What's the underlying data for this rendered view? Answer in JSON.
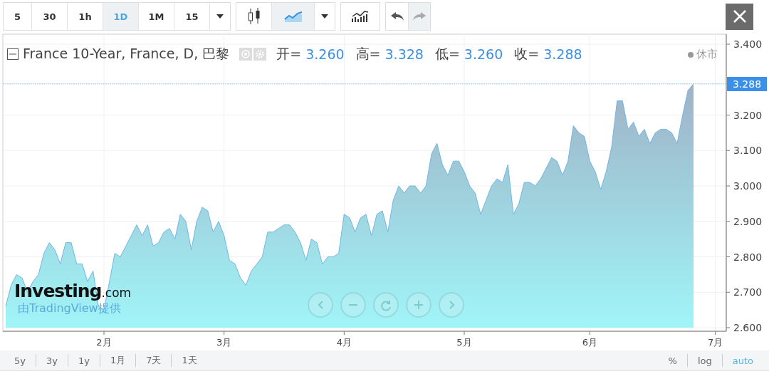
{
  "toolbar": {
    "intervals": [
      {
        "label": "5",
        "selected": false
      },
      {
        "label": "30",
        "selected": false
      },
      {
        "label": "1h",
        "selected": false
      },
      {
        "label": "1D",
        "selected": true
      },
      {
        "label": "1M",
        "selected": false
      },
      {
        "label": "15",
        "selected": false
      }
    ],
    "chart_styles": [
      {
        "kind": "candles",
        "selected": false
      },
      {
        "kind": "area",
        "selected": true
      }
    ],
    "undo": {
      "disabled": false
    },
    "redo": {
      "disabled": true
    }
  },
  "legend": {
    "title": "France 10-Year, France, D, 巴黎",
    "fields": [
      {
        "label": "开=",
        "value": "3.260"
      },
      {
        "label": "高=",
        "value": "3.328"
      },
      {
        "label": "低=",
        "value": "3.260"
      },
      {
        "label": "收=",
        "value": "3.288"
      }
    ],
    "market_status": "休市"
  },
  "chart": {
    "price_tag": "3.288",
    "chart_data": {
      "type": "area",
      "categories": [
        null,
        null,
        null,
        null,
        null,
        null,
        null,
        null,
        null,
        null,
        null,
        null,
        null,
        null,
        null,
        null,
        null,
        null,
        "2月",
        null,
        null,
        null,
        null,
        null,
        null,
        null,
        null,
        null,
        null,
        null,
        null,
        null,
        null,
        null,
        null,
        null,
        null,
        null,
        null,
        null,
        "3月",
        null,
        null,
        null,
        null,
        null,
        null,
        null,
        null,
        null,
        null,
        null,
        null,
        null,
        null,
        null,
        null,
        null,
        null,
        null,
        null,
        null,
        "4月",
        null,
        null,
        null,
        null,
        null,
        null,
        null,
        null,
        null,
        null,
        null,
        null,
        null,
        null,
        null,
        null,
        null,
        null,
        null,
        null,
        null,
        "5月",
        null,
        null,
        null,
        null,
        null,
        null,
        null,
        null,
        null,
        null,
        null,
        null,
        null,
        null,
        null,
        null,
        null,
        null,
        null,
        null,
        null,
        null,
        "6月",
        null,
        null,
        null,
        null,
        null,
        null,
        null,
        null,
        null,
        null,
        null,
        null,
        null,
        null,
        null,
        null,
        null,
        null,
        null,
        null,
        null,
        null,
        "7月"
      ],
      "series": [
        {
          "color": "#6fb6e6",
          "values": [
            2.66,
            2.72,
            2.75,
            2.74,
            2.7,
            2.73,
            2.75,
            2.81,
            2.84,
            2.82,
            2.78,
            2.84,
            2.84,
            2.78,
            2.78,
            2.73,
            2.76,
            2.66,
            2.65,
            2.73,
            2.81,
            2.8,
            2.83,
            2.86,
            2.89,
            2.86,
            2.89,
            2.83,
            2.84,
            2.87,
            2.88,
            2.85,
            2.92,
            2.9,
            2.82,
            2.9,
            2.94,
            2.93,
            2.87,
            2.9,
            2.86,
            2.79,
            2.78,
            2.74,
            2.72,
            2.76,
            2.78,
            2.8,
            2.87,
            2.87,
            2.88,
            2.89,
            2.89,
            2.87,
            2.84,
            2.79,
            2.85,
            2.84,
            2.78,
            2.8,
            2.8,
            2.81,
            2.92,
            2.91,
            2.87,
            2.91,
            2.92,
            2.86,
            2.92,
            2.93,
            2.87,
            2.96,
            3.0,
            2.98,
            3.0,
            3.0,
            2.98,
            3.0,
            3.09,
            3.12,
            3.06,
            3.03,
            3.07,
            3.07,
            3.04,
            3.0,
            2.98,
            2.92,
            2.96,
            3.0,
            3.02,
            3.01,
            3.06,
            2.92,
            2.95,
            3.01,
            3.01,
            3.0,
            3.02,
            3.05,
            3.08,
            3.07,
            3.03,
            3.07,
            3.17,
            3.15,
            3.14,
            3.07,
            3.04,
            2.99,
            3.04,
            3.11,
            3.24,
            3.24,
            3.16,
            3.18,
            3.14,
            3.16,
            3.12,
            3.15,
            3.16,
            3.16,
            3.15,
            3.12,
            3.2,
            3.27,
            3.288,
            null,
            null,
            null,
            null
          ]
        }
      ],
      "ylim": [
        2.6,
        3.4
      ],
      "grid": true,
      "ref_lines": [
        {
          "axis": "y",
          "value": 3.288
        }
      ],
      "yticks": [
        {
          "value": 2.6,
          "label": "2.600"
        },
        {
          "value": 2.7,
          "label": "2.700"
        },
        {
          "value": 2.8,
          "label": "2.800"
        },
        {
          "value": 2.9,
          "label": "2.900"
        },
        {
          "value": 3.0,
          "label": "3.000"
        },
        {
          "value": 3.1,
          "label": "3.100"
        },
        {
          "value": 3.2,
          "label": "3.200"
        },
        {
          "value": 3.4,
          "label": "3.400"
        }
      ]
    }
  },
  "logo": {
    "brand": "Investing",
    "suffix": ".com",
    "credit": "由TradingView提供"
  },
  "range_bar": {
    "ranges": [
      {
        "label": "5y",
        "selected": false
      },
      {
        "label": "3y",
        "selected": false
      },
      {
        "label": "1y",
        "selected": false
      },
      {
        "label": "1月",
        "selected": false
      },
      {
        "label": "7天",
        "selected": false
      },
      {
        "label": "1天",
        "selected": false
      }
    ],
    "scale_options": [
      {
        "label": "%",
        "selected": false
      },
      {
        "label": "log",
        "selected": false
      },
      {
        "label": "auto",
        "selected": true
      }
    ]
  }
}
